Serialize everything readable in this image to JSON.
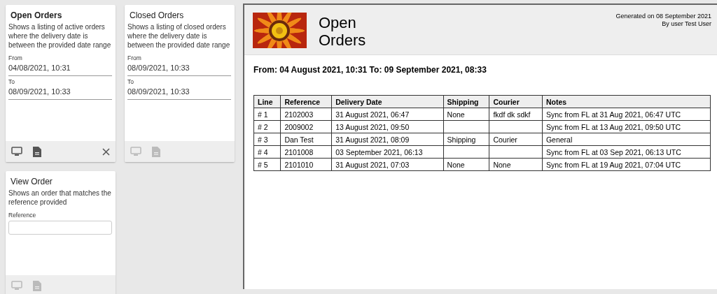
{
  "cards": [
    {
      "title": "Open Orders",
      "selected": true,
      "description": "Shows a listing of active orders where the delivery date is between the provided date range",
      "fields": [
        {
          "kind": "date",
          "label": "From",
          "value": "04/08/2021, 10:31"
        },
        {
          "kind": "date",
          "label": "To",
          "value": "08/09/2021, 10:33"
        }
      ]
    },
    {
      "title": "Closed Orders",
      "selected": false,
      "description": "Shows a listing of closed orders where the delivery date is between the provided date range",
      "fields": [
        {
          "kind": "date",
          "label": "From",
          "value": "08/09/2021, 10:33"
        },
        {
          "kind": "date",
          "label": "To",
          "value": "08/09/2021, 10:33"
        }
      ]
    },
    {
      "title": "View Order",
      "selected": false,
      "description": "Shows an order that matches the reference provided",
      "fields": [
        {
          "kind": "text",
          "label": "Reference"
        }
      ]
    }
  ],
  "report": {
    "title": "Open Orders",
    "generated": "Generated on 08 September 2021",
    "user": "By user Test User",
    "range": "From: 04 August 2021, 10:31 To: 09 September 2021, 08:33",
    "table": {
      "columns": [
        "Line",
        "Reference",
        "Delivery Date",
        "Shipping",
        "Courier",
        "Notes"
      ],
      "rows": [
        {
          "line": "# 1",
          "reference": "2102003",
          "delivery_date": "31 August 2021, 06:47",
          "shipping": "None",
          "courier": "fkdf dk sdkf",
          "notes": "Sync from FL at 31 Aug 2021, 06:47 UTC"
        },
        {
          "line": "# 2",
          "reference": "2009002",
          "delivery_date": "13 August 2021, 09:50",
          "notes": "Sync from FL at 13 Aug 2021, 09:50 UTC"
        },
        {
          "line": "# 3",
          "reference": "Dan Test",
          "delivery_date": "31 August 2021, 08:09",
          "shipping": "Shipping",
          "courier": "Courier",
          "notes": "General"
        },
        {
          "line": "# 4",
          "reference": "2101008",
          "delivery_date": "03 September 2021, 06:13",
          "notes": "Sync from FL at 03 Sep 2021, 06:13 UTC"
        },
        {
          "line": "# 5",
          "reference": "2101010",
          "delivery_date": "31 August 2021, 07:03",
          "shipping": "None",
          "courier": "None",
          "notes": "Sync from FL at 19 Aug 2021, 07:04 UTC"
        }
      ]
    }
  }
}
